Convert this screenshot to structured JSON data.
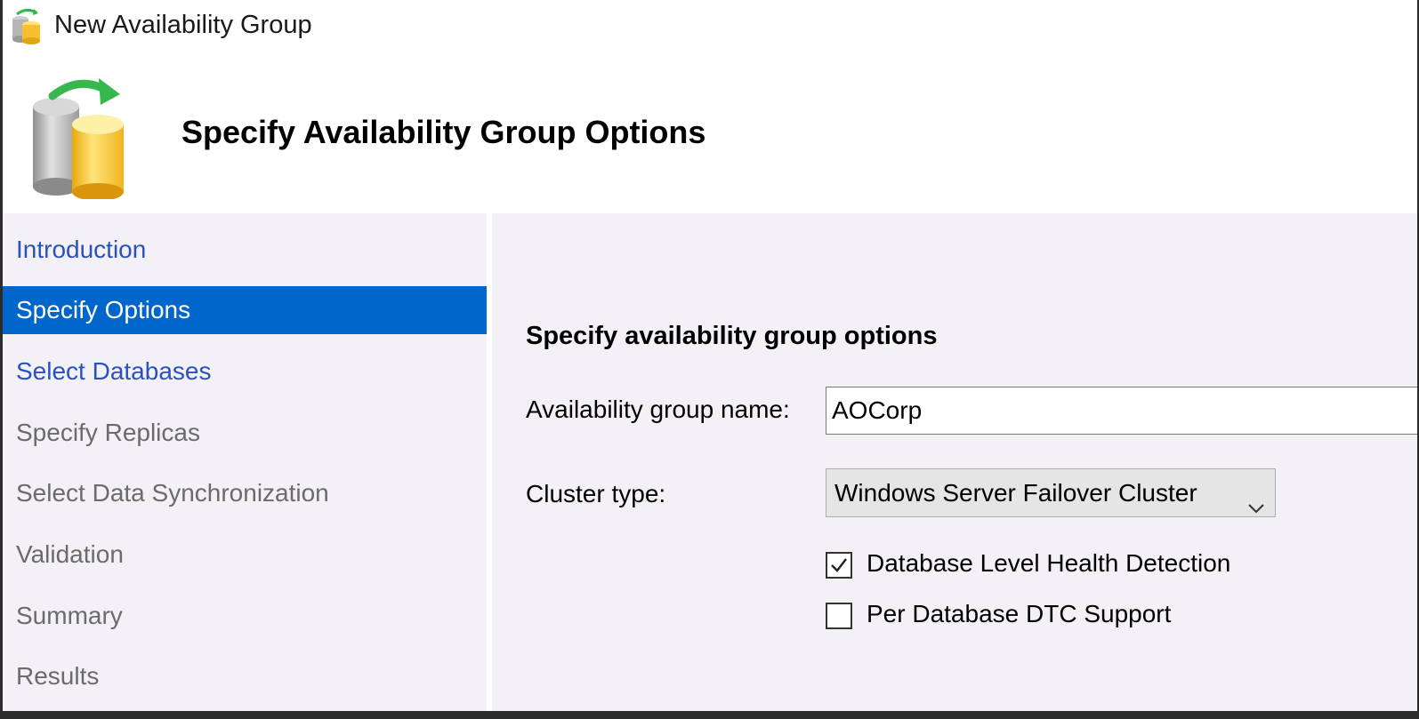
{
  "window": {
    "title": "New Availability Group",
    "app_icon": "availability-group-icon"
  },
  "header": {
    "title": "Specify Availability Group Options",
    "icon": "database-sync-icon"
  },
  "sidebar": {
    "items": [
      {
        "label": "Introduction",
        "state": "link"
      },
      {
        "label": "Specify Options",
        "state": "active"
      },
      {
        "label": "Select Databases",
        "state": "link"
      },
      {
        "label": "Specify Replicas",
        "state": "disabled"
      },
      {
        "label": "Select Data Synchronization",
        "state": "disabled"
      },
      {
        "label": "Validation",
        "state": "disabled"
      },
      {
        "label": "Summary",
        "state": "disabled"
      },
      {
        "label": "Results",
        "state": "disabled"
      }
    ]
  },
  "main": {
    "section_title": "Specify availability group options",
    "ag_name_label": "Availability group name:",
    "ag_name_value": "AOCorp",
    "cluster_type_label": "Cluster type:",
    "cluster_type_value": "Windows Server Failover Cluster",
    "health_detection_label": "Database Level Health Detection",
    "health_detection_checked": true,
    "dtc_support_label": "Per Database DTC Support",
    "dtc_support_checked": false
  },
  "colors": {
    "active_nav": "#0066cc",
    "link": "#2a52be",
    "disabled": "#6b6b6b",
    "panel_bg": "#f4f1f6"
  }
}
